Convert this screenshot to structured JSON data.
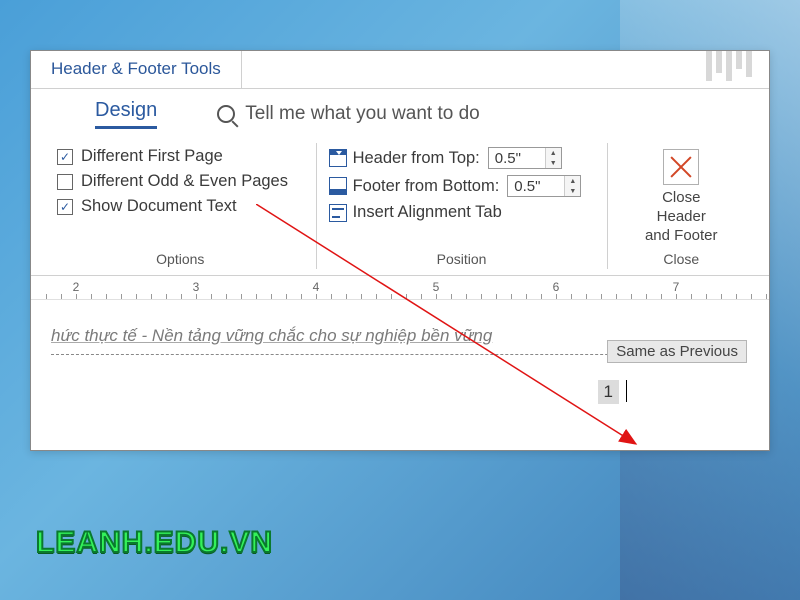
{
  "titlebar": {
    "text": "Header & Footer Tools"
  },
  "tabs": {
    "design": "Design"
  },
  "tellme": {
    "placeholder": "Tell me what you want to do"
  },
  "options": {
    "diff_first": {
      "label": "Different First Page",
      "checked": "✓"
    },
    "diff_odd_even": {
      "label": "Different Odd & Even Pages",
      "checked": ""
    },
    "show_doc": {
      "label": "Show Document Text",
      "checked": "✓"
    },
    "group_label": "Options"
  },
  "position": {
    "header_from_top": {
      "label": "Header from Top:",
      "value": "0.5\""
    },
    "footer_from_bottom": {
      "label": "Footer from Bottom:",
      "value": "0.5\""
    },
    "insert_alignment": {
      "label": "Insert Alignment Tab"
    },
    "group_label": "Position"
  },
  "close": {
    "label_line1": "Close Header",
    "label_line2": "and Footer",
    "group_label": "Close"
  },
  "ruler": {
    "marks": [
      "2",
      "3",
      "4",
      "5",
      "6",
      "7"
    ]
  },
  "doc": {
    "header_text": "hức thực tế - Nền tảng vững chắc cho sự nghiệp bền vững",
    "same_as_previous": "Same as Previous",
    "page_number": "1"
  },
  "watermark": {
    "text": "LEANH.EDU.VN"
  }
}
